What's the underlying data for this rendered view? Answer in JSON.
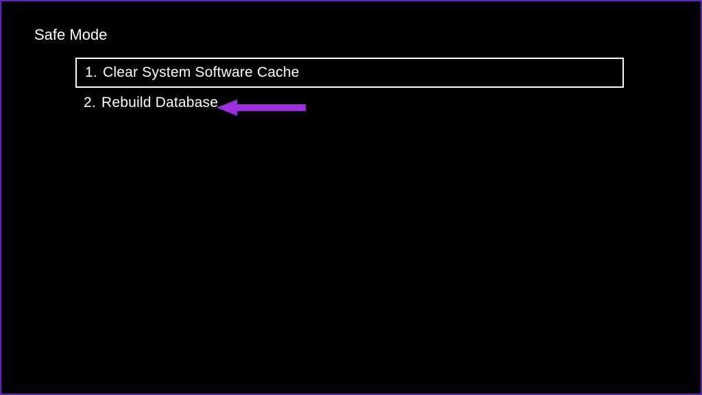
{
  "screen": {
    "title": "Safe Mode"
  },
  "menu": {
    "items": [
      {
        "number": "1.",
        "label": "Clear System Software Cache",
        "selected": true
      },
      {
        "number": "2.",
        "label": "Rebuild Database",
        "selected": false
      }
    ]
  },
  "annotation": {
    "arrow_color": "#9b2fd9"
  }
}
